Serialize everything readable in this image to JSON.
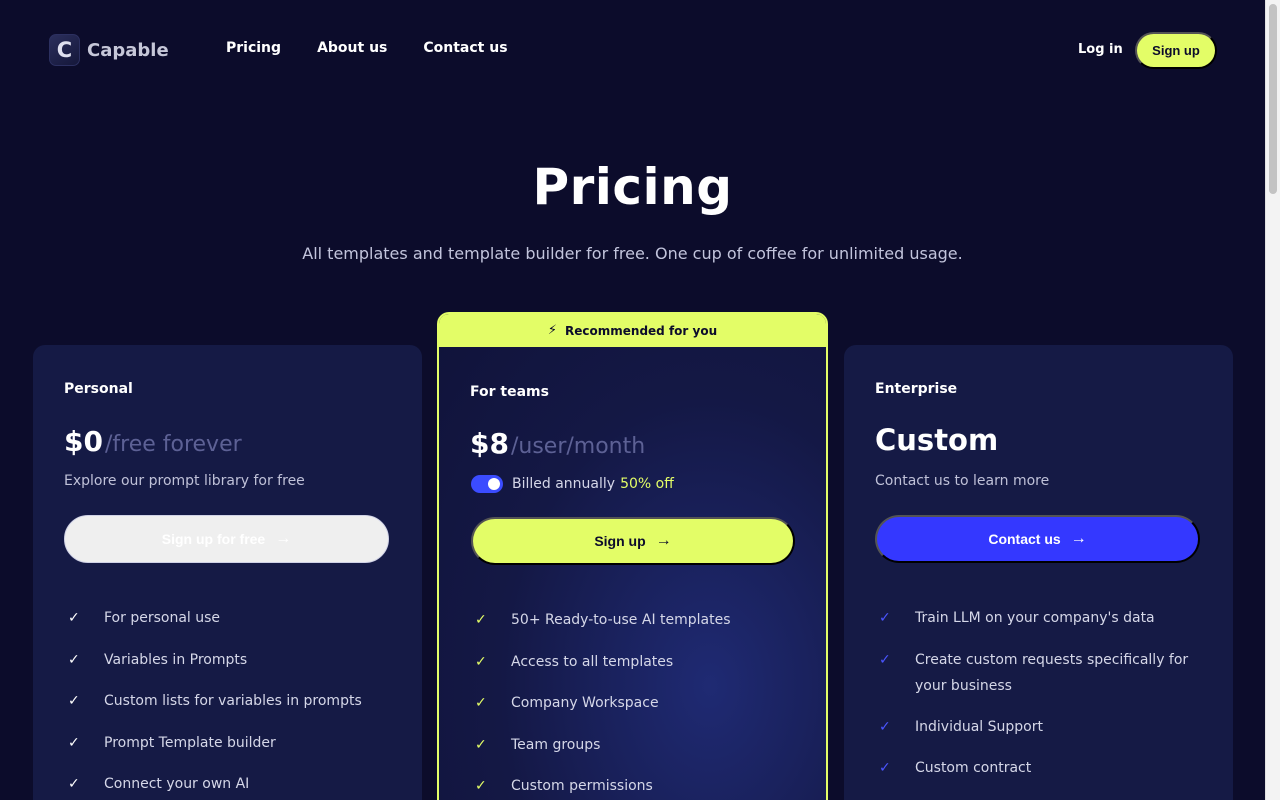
{
  "brand": {
    "logo_letter": "C",
    "name": "Capable"
  },
  "nav": {
    "links": [
      "Pricing",
      "About us",
      "Contact us"
    ],
    "login": "Log in",
    "signup": "Sign up"
  },
  "hero": {
    "title": "Pricing",
    "subtitle": "All templates and template builder for free. One cup of coffee for unlimited usage."
  },
  "plans": {
    "personal": {
      "name": "Personal",
      "price": "$0",
      "price_suffix": "/free forever",
      "description": "Explore our prompt library for free",
      "cta": "Sign up for free",
      "features": [
        "For personal use",
        "Variables in Prompts",
        "Custom lists for variables in prompts",
        "Prompt Template builder",
        "Connect your own AI"
      ]
    },
    "teams": {
      "badge": "Recommended for you",
      "name": "For teams",
      "price": "$8",
      "price_suffix": "/user/month",
      "billing_label": "Billed annually",
      "billing_discount": "50% off",
      "billing_annual_on": true,
      "cta": "Sign up",
      "features": [
        "50+ Ready-to-use AI templates",
        "Access to all templates",
        "Company Workspace",
        "Team groups",
        "Custom permissions"
      ]
    },
    "enterprise": {
      "name": "Enterprise",
      "price": "Custom",
      "description": "Contact us to learn more",
      "cta": "Contact us",
      "features": [
        "Train LLM on your company's data",
        "Create custom requests specifically for your business",
        " Individual Support",
        "Custom contract"
      ]
    }
  },
  "icons": {
    "check": "check-icon",
    "arrow": "arrow-right-icon",
    "bolt": "lightning-bolt-icon"
  },
  "colors": {
    "background": "#0c0c2b",
    "accent_lime": "#e3fd67",
    "accent_blue": "#3438ff",
    "card": "#151a45"
  }
}
